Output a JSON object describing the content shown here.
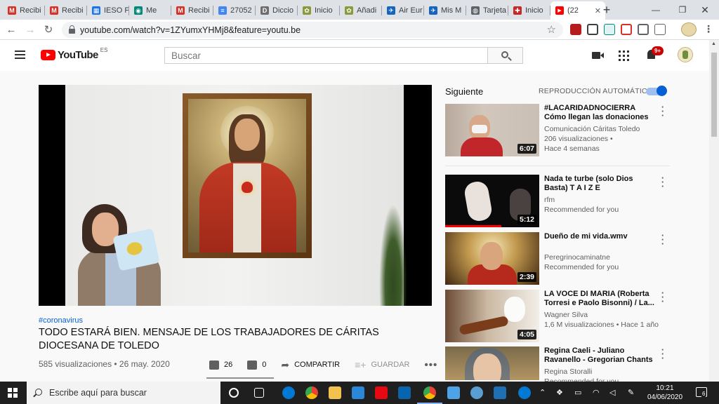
{
  "browser": {
    "tabs": [
      {
        "label": "Recibi",
        "icon": "gmail-icon",
        "color": "#d93025",
        "glyph": "M"
      },
      {
        "label": "Recibi",
        "icon": "gmail-icon",
        "color": "#d93025",
        "glyph": "M"
      },
      {
        "label": "IESO F",
        "icon": "school-icon",
        "color": "#1a73e8",
        "glyph": "▦"
      },
      {
        "label": "Me",
        "icon": "meet-icon",
        "color": "#00897b",
        "glyph": "◉"
      },
      {
        "label": "Recibi",
        "icon": "gmail-icon",
        "color": "#d93025",
        "glyph": "M"
      },
      {
        "label": "27052",
        "icon": "docs-icon",
        "color": "#4285f4",
        "glyph": "≡"
      },
      {
        "label": "Diccio",
        "icon": "dictionary-icon",
        "color": "#6d6d6d",
        "glyph": "D"
      },
      {
        "label": "Inicio",
        "icon": "site-icon",
        "color": "#8a9a3a",
        "glyph": "✿"
      },
      {
        "label": "Añadi",
        "icon": "site-icon",
        "color": "#8a9a3a",
        "glyph": "✿"
      },
      {
        "label": "Air Eur",
        "icon": "plane-icon",
        "color": "#1565c0",
        "glyph": "✈"
      },
      {
        "label": "Mis M",
        "icon": "plane-icon",
        "color": "#1565c0",
        "glyph": "✈"
      },
      {
        "label": "Tarjeta",
        "icon": "globe-icon",
        "color": "#5f6368",
        "glyph": "◍"
      },
      {
        "label": "Inicio",
        "icon": "caritas-icon",
        "color": "#c62828",
        "glyph": "✚"
      }
    ],
    "active_tab": {
      "label": "(22",
      "icon": "youtube-icon",
      "color": "#ff0000",
      "glyph": "▶"
    },
    "url": "youtube.com/watch?v=1ZYumxYHMj8&feature=youtu.be"
  },
  "youtube": {
    "logo_text": "YouTube",
    "country": "ES",
    "search_placeholder": "Buscar",
    "notifications": "9+"
  },
  "video": {
    "hashtag": "#coronavirus",
    "title": "TODO ESTARÁ BIEN. MENSAJE DE LOS TRABAJADORES DE CÁRITAS DIOCESANA DE TOLEDO",
    "meta": "585 visualizaciones • 26 may. 2020",
    "likes": "26",
    "dislikes": "0",
    "share": "COMPARTIR",
    "save": "GUARDAR"
  },
  "sidebar": {
    "next_label": "Siguiente",
    "autoplay_label": "REPRODUCCIÓN AUTOMÁTICA",
    "items": [
      {
        "title": "#LACARIDADNOCIERRA Cómo llegan las donaciones de las...",
        "channel": "Comunicación Cáritas Toledo",
        "line2": "206 visualizaciones •",
        "line3": "Hace 4 semanas",
        "duration": "6:07",
        "watched": 0
      },
      {
        "title": "Nada te turbe (solo Dios Basta) T A I Z E",
        "channel": "rfm",
        "line2": "Recommended for you",
        "line3": "",
        "duration": "5:12",
        "watched": 0.6
      },
      {
        "title": "Dueño de mi vida.wmv",
        "channel": "Peregrinocaminatne",
        "line2": "Recommended for you",
        "line3": "",
        "duration": "2:39",
        "watched": 0
      },
      {
        "title": "LA VOCE DI MARIA (Roberta Torresi e Paolo Bisonni) / La...",
        "channel": "Wagner Silva",
        "line2": "1,6 M visualizaciones • Hace 1 año",
        "line3": "",
        "duration": "4:05",
        "watched": 0
      },
      {
        "title": "Regina Caeli - Juliano Ravanello - Gregorian Chants",
        "channel": "Regina Storalli",
        "line2": "Recommended for you",
        "line3": "",
        "duration": "",
        "watched": 0
      }
    ]
  },
  "taskbar": {
    "search_text": "Escribe aquí para buscar",
    "time": "10:21",
    "date": "04/06/2020",
    "notifications": "6"
  }
}
